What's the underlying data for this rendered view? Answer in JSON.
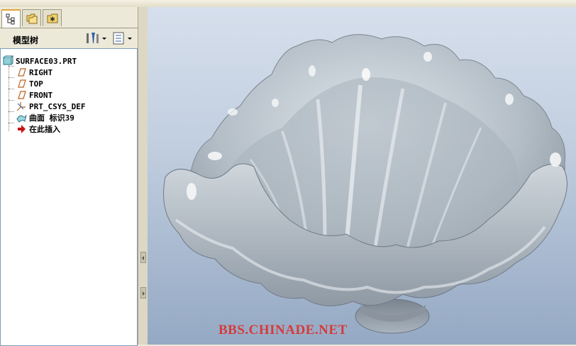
{
  "model_tree": {
    "title": "模型树",
    "nodes": [
      {
        "label": "SURFACE03.PRT",
        "icon": "part-icon"
      },
      {
        "label": "RIGHT",
        "icon": "datum-plane-icon"
      },
      {
        "label": "TOP",
        "icon": "datum-plane-icon"
      },
      {
        "label": "FRONT",
        "icon": "datum-plane-icon"
      },
      {
        "label": "PRT_CSYS_DEF",
        "icon": "csys-icon"
      },
      {
        "label": "曲面 标识39",
        "icon": "surface-feature-icon"
      },
      {
        "label": "在此插入",
        "icon": "insert-here-arrow-icon"
      }
    ]
  },
  "tabs": [
    {
      "icon": "model-tree-icon"
    },
    {
      "icon": "folder-browser-icon"
    },
    {
      "icon": "favorites-icon"
    }
  ],
  "viewport": {
    "watermark": "BBS.CHINADE.NET",
    "model": "shell-surface-model",
    "watermark_color": "#d63a3a"
  }
}
